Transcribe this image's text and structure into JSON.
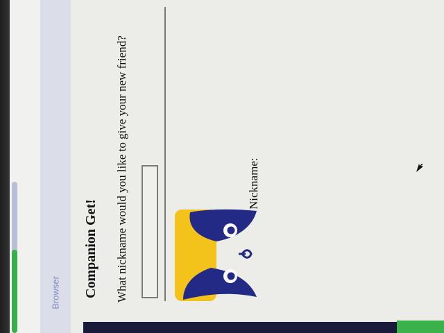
{
  "browser": {
    "label": "Browser"
  },
  "page": {
    "title": "Companion Get!",
    "prompt": "What nickname would you like to give your new friend?",
    "nickname_input": {
      "value": "",
      "placeholder": ""
    },
    "nickname_label": "Nickname:",
    "nickname_value": ""
  },
  "colors": {
    "accent_green": "#38b04a",
    "avatar_yellow": "#f3c21b",
    "avatar_blue": "#232a86",
    "bottom_bar": "#1a1a3a"
  },
  "icons": {
    "avatar": "companion-creature-icon",
    "cursor": "mouse-cursor-icon"
  }
}
